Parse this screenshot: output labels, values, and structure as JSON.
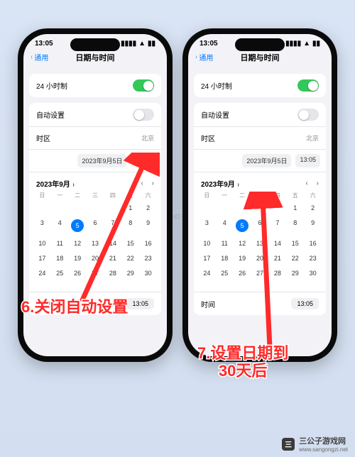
{
  "status": {
    "time": "13:05"
  },
  "nav": {
    "back": "通用",
    "title": "日期与时间"
  },
  "rows": {
    "format24h": "24 小时制",
    "autoset": "自动设置",
    "timezone": {
      "label": "时区",
      "value": "北京"
    },
    "date_pill": "2023年9月5日",
    "time_pill": "13:05",
    "month_label": "2023年9月",
    "time_label": "时间",
    "time_value": "13:05"
  },
  "weekdays": [
    "日",
    "一",
    "二",
    "三",
    "四",
    "五",
    "六"
  ],
  "days": [
    "",
    "",
    "",
    "",
    "",
    "1",
    "2",
    "3",
    "4",
    "5",
    "6",
    "7",
    "8",
    "9",
    "10",
    "11",
    "12",
    "13",
    "14",
    "15",
    "16",
    "17",
    "18",
    "19",
    "20",
    "21",
    "22",
    "23",
    "24",
    "25",
    "26",
    "27",
    "28",
    "29",
    "30",
    ""
  ],
  "selected_index": 9,
  "captions": {
    "left": "6.关闭自动设置",
    "right_l1": "7.设置日期到",
    "right_l2": "30天后"
  },
  "watermark": {
    "name": "三公子游戏网",
    "url": "www.sangongzi.net"
  },
  "side_wm": "小红书"
}
